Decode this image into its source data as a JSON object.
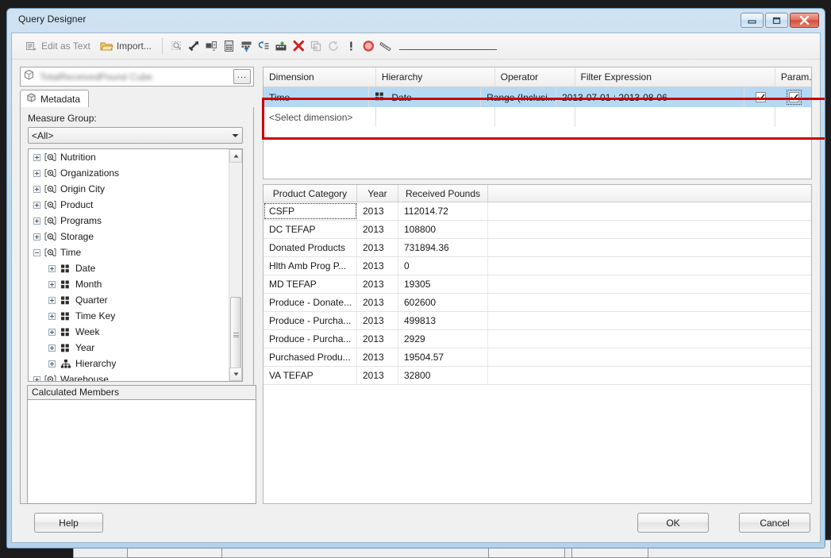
{
  "window": {
    "title": "Query Designer",
    "controls": {
      "minimize": "minimize-button",
      "maximize": "maximize-button",
      "close": "close-button"
    }
  },
  "toolbar": {
    "edit_as_text": "Edit as Text",
    "import": "Import...",
    "icons": [
      "design-mode-icon",
      "arrow-pointer-icon",
      "add-query-icon",
      "calculator-icon",
      "show-aggregations-icon",
      "auto-execute-icon",
      "add-calculated-member-icon",
      "delete-icon",
      "copy-icon",
      "refresh-icon",
      "exclamation-icon",
      "stop-icon",
      "ruler-icon"
    ]
  },
  "metadata_panel": {
    "cube_name": "TotalReceivedPound Cube",
    "browse_button": "...",
    "tab_label": "Metadata",
    "measure_group_label": "Measure Group:",
    "measure_group_value": "<All>",
    "tree": [
      {
        "label": "Nutrition",
        "icon": "dimension-icon",
        "indent": 0,
        "expanded": false
      },
      {
        "label": "Organizations",
        "icon": "dimension-icon",
        "indent": 0,
        "expanded": false
      },
      {
        "label": "Origin City",
        "icon": "dimension-icon",
        "indent": 0,
        "expanded": false
      },
      {
        "label": "Product",
        "icon": "dimension-icon",
        "indent": 0,
        "expanded": false
      },
      {
        "label": "Programs",
        "icon": "dimension-icon",
        "indent": 0,
        "expanded": false
      },
      {
        "label": "Storage",
        "icon": "dimension-icon",
        "indent": 0,
        "expanded": false
      },
      {
        "label": "Time",
        "icon": "dimension-icon",
        "indent": 0,
        "expanded": true
      },
      {
        "label": "Date",
        "icon": "attribute-icon",
        "indent": 1,
        "expanded": false
      },
      {
        "label": "Month",
        "icon": "attribute-icon",
        "indent": 1,
        "expanded": false
      },
      {
        "label": "Quarter",
        "icon": "attribute-icon",
        "indent": 1,
        "expanded": false
      },
      {
        "label": "Time Key",
        "icon": "attribute-icon",
        "indent": 1,
        "expanded": false
      },
      {
        "label": "Week",
        "icon": "attribute-icon",
        "indent": 1,
        "expanded": false
      },
      {
        "label": "Year",
        "icon": "attribute-icon",
        "indent": 1,
        "expanded": false
      },
      {
        "label": "Hierarchy",
        "icon": "hierarchy-icon",
        "indent": 1,
        "expanded": false
      },
      {
        "label": "Warehouse",
        "icon": "dimension-icon",
        "indent": 0,
        "expanded": false
      }
    ],
    "calculated_members_label": "Calculated Members"
  },
  "filter_grid": {
    "columns": [
      "Dimension",
      "Hierarchy",
      "Operator",
      "Filter Expression",
      "Param..."
    ],
    "rows": [
      {
        "dimension": "Time",
        "hierarchy": "Date",
        "hierarchy_icon": "attribute-icon",
        "operator": "Range (Inclusi...",
        "filter_expression": "2013-07-01  :  2013-08-06",
        "param_checked": true,
        "param2_checked": true,
        "selected": true
      }
    ],
    "new_row_placeholder": "<Select dimension>"
  },
  "result_grid": {
    "columns": [
      "Product Category",
      "Year",
      "Received Pounds"
    ],
    "rows": [
      [
        "CSFP",
        "2013",
        "112014.72"
      ],
      [
        "DC TEFAP",
        "2013",
        "108800"
      ],
      [
        "Donated Products",
        "2013",
        "731894.36"
      ],
      [
        "Hlth Amb Prog P...",
        "2013",
        "0"
      ],
      [
        "MD  TEFAP",
        "2013",
        "19305"
      ],
      [
        "Produce - Donate...",
        "2013",
        "602600"
      ],
      [
        "Produce - Purcha...",
        "2013",
        "499813"
      ],
      [
        "Produce - Purcha...",
        "2013",
        "2929"
      ],
      [
        "Purchased Produ...",
        "2013",
        "19504.57"
      ],
      [
        "VA TEFAP",
        "2013",
        "32800"
      ]
    ]
  },
  "footer": {
    "help": "Help",
    "ok": "OK",
    "cancel": "Cancel"
  }
}
